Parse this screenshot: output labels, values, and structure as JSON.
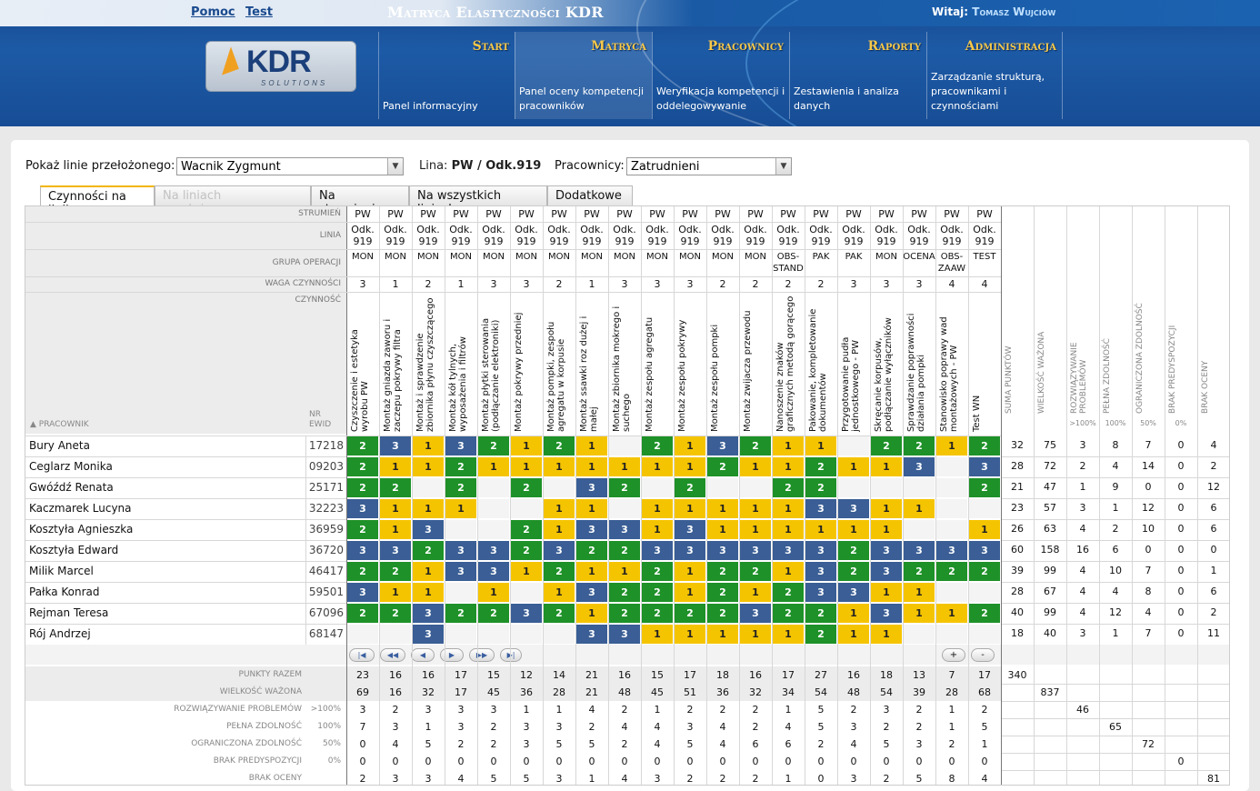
{
  "header": {
    "links": [
      "Pomoc",
      "Test"
    ],
    "app_title": "Matryca Elastyczności KDR",
    "welcome_prefix": "Witaj:",
    "user": "Tomasz Wujciów",
    "logo_text": "KDR",
    "logo_sub": "SOLUTIONS"
  },
  "nav": [
    {
      "title": "Start",
      "desc": "Panel informacyjny"
    },
    {
      "title": "Matryca",
      "desc": "Panel oceny kompetencji pracowników"
    },
    {
      "title": "Pracownicy",
      "desc": "Weryfikacja kompetencji i oddelegowywanie"
    },
    {
      "title": "Raporty",
      "desc": "Zestawienia i analiza danych"
    },
    {
      "title": "Administracja",
      "desc": "Zarządzanie strukturą, pracownikami i czynnościami"
    }
  ],
  "filters": {
    "supervisor_label": "Pokaż linie przełożonego:",
    "supervisor_value": "Wacnik Zygmunt",
    "line_label": "Lina:",
    "line_value": "PW / Odk.919",
    "workers_label": "Pracownicy:",
    "workers_value": "Zatrudnieni"
  },
  "tabs": [
    "Czynności na linii",
    "Na liniach przełożonego",
    "Na strumieniu",
    "Na wszystkich liniach",
    "Dodatkowe"
  ],
  "grid": {
    "row_headers": [
      "STRUMIEŃ",
      "LINIA",
      "GRUPA OPERACJI",
      "WAGA CZYNNOŚCI",
      "CZYNNOŚĆ"
    ],
    "employee_header": "▲ PRACOWNIK",
    "ewid_header": "NR EWID",
    "stream": [
      "PW",
      "PW",
      "PW",
      "PW",
      "PW",
      "PW",
      "PW",
      "PW",
      "PW",
      "PW",
      "PW",
      "PW",
      "PW",
      "PW",
      "PW",
      "PW",
      "PW",
      "PW",
      "PW",
      "PW"
    ],
    "line": [
      "Odk. 919",
      "Odk. 919",
      "Odk. 919",
      "Odk. 919",
      "Odk. 919",
      "Odk. 919",
      "Odk. 919",
      "Odk. 919",
      "Odk. 919",
      "Odk. 919",
      "Odk. 919",
      "Odk. 919",
      "Odk. 919",
      "Odk. 919",
      "Odk. 919",
      "Odk. 919",
      "Odk. 919",
      "Odk. 919",
      "Odk. 919",
      "Odk. 919"
    ],
    "group": [
      "MON",
      "MON",
      "MON",
      "MON",
      "MON",
      "MON",
      "MON",
      "MON",
      "MON",
      "MON",
      "MON",
      "MON",
      "MON",
      "OBS-STAND",
      "PAK",
      "PAK",
      "MON",
      "OCENA",
      "OBS-ZAAW",
      "TEST"
    ],
    "weight": [
      "3",
      "1",
      "2",
      "1",
      "3",
      "3",
      "2",
      "1",
      "3",
      "3",
      "3",
      "2",
      "2",
      "2",
      "2",
      "3",
      "3",
      "3",
      "4",
      "4"
    ],
    "activities": [
      "Czyszczenie i estetyka wyrobu PW",
      "Montaż gniazda zaworu i zaczepu pokrywy filtra",
      "Montaż i sprawdzenie zbiornika płynu czyszczącego",
      "Montaż kół tylnych, wyposażenia i filtrów",
      "Montaż płytki sterowania (podłączanie elektroniki)",
      "Montaż pokrywy przedniej",
      "Montaż pompki, zespołu agregatu w korpusie",
      "Montaż ssawki roz dużej i małej",
      "Montaż zbiornika mokrego i suchego",
      "Montaż zespołu agregatu",
      "Montaż zespołu pokrywy",
      "Montaż zespołu pompki",
      "Montaż zwijacza przewodu",
      "Nanoszenie znaków graficznych metodą gorącego",
      "Pakowanie, kompletowanie dokumentów",
      "Przygotowanie pudła jednostkowego - PW",
      "Skręcanie korpusów, podłączanie wyłączników",
      "Sprawdzanie poprawności działania pompki",
      "Stanowisko poprawy wad montażowych - PW",
      "Test WN"
    ],
    "summary_headers": [
      "SUMA PUNKTÓW",
      "WIELKOŚĆ WAŻONA",
      "ROZWIĄZYWANIE PROBLEMÓW",
      "PEŁNA ZDOLNOŚĆ",
      "OGRANICZONA ZDOLNOŚĆ",
      "BRAK PREDYSPOZYCJI",
      "BRAK OCENY"
    ],
    "summary_sub": [
      "",
      "",
      ">100%",
      "100%",
      "50%",
      "0%",
      ""
    ],
    "employees": [
      {
        "name": "Bury Aneta",
        "ewid": "17218",
        "levels": [
          "2",
          "3",
          "1",
          "3",
          "2",
          "1",
          "2",
          "1",
          "",
          "2",
          "1",
          "3",
          "2",
          "1",
          "1",
          "",
          "2",
          "2",
          "1",
          "2"
        ],
        "summary": [
          "32",
          "75",
          "3",
          "8",
          "7",
          "0",
          "4"
        ]
      },
      {
        "name": "Ceglarz Monika",
        "ewid": "09203",
        "levels": [
          "2",
          "1",
          "1",
          "2",
          "1",
          "1",
          "1",
          "1",
          "1",
          "1",
          "1",
          "2",
          "1",
          "1",
          "2",
          "1",
          "1",
          "3",
          "",
          "3"
        ],
        "summary": [
          "28",
          "72",
          "2",
          "4",
          "14",
          "0",
          "2"
        ]
      },
      {
        "name": "Gwóźdź Renata",
        "ewid": "25171",
        "levels": [
          "2",
          "2",
          "",
          "2",
          "",
          "2",
          "",
          "3",
          "2",
          "",
          "2",
          "",
          "",
          "2",
          "2",
          "",
          "",
          "",
          "",
          "2"
        ],
        "summary": [
          "21",
          "47",
          "1",
          "9",
          "0",
          "0",
          "12"
        ]
      },
      {
        "name": "Kaczmarek Lucyna",
        "ewid": "32223",
        "levels": [
          "3",
          "1",
          "1",
          "1",
          "",
          "",
          "1",
          "1",
          "",
          "1",
          "1",
          "1",
          "1",
          "1",
          "3",
          "3",
          "1",
          "1",
          "",
          ""
        ],
        "summary": [
          "23",
          "57",
          "3",
          "1",
          "12",
          "0",
          "6"
        ]
      },
      {
        "name": "Kosztyła Agnieszka",
        "ewid": "36959",
        "levels": [
          "2",
          "1",
          "3",
          "",
          "",
          "2",
          "1",
          "3",
          "3",
          "1",
          "3",
          "1",
          "1",
          "1",
          "1",
          "1",
          "1",
          "",
          "",
          "1"
        ],
        "summary": [
          "26",
          "63",
          "4",
          "2",
          "10",
          "0",
          "6"
        ]
      },
      {
        "name": "Kosztyła Edward",
        "ewid": "36720",
        "levels": [
          "3",
          "3",
          "2",
          "3",
          "3",
          "2",
          "3",
          "2",
          "2",
          "3",
          "3",
          "3",
          "3",
          "3",
          "3",
          "2",
          "3",
          "3",
          "3",
          "3"
        ],
        "summary": [
          "60",
          "158",
          "16",
          "6",
          "0",
          "0",
          "0"
        ]
      },
      {
        "name": "Milik Marcel",
        "ewid": "46417",
        "levels": [
          "2",
          "2",
          "1",
          "3",
          "3",
          "1",
          "2",
          "1",
          "1",
          "2",
          "1",
          "2",
          "2",
          "1",
          "3",
          "2",
          "3",
          "2",
          "2",
          "2"
        ],
        "summary": [
          "39",
          "99",
          "4",
          "10",
          "7",
          "0",
          "1"
        ]
      },
      {
        "name": "Pałka Konrad",
        "ewid": "59501",
        "levels": [
          "3",
          "1",
          "1",
          "",
          "1",
          "",
          "1",
          "3",
          "2",
          "2",
          "1",
          "2",
          "1",
          "2",
          "3",
          "3",
          "1",
          "1",
          "",
          ""
        ],
        "summary": [
          "28",
          "67",
          "4",
          "4",
          "8",
          "0",
          "6"
        ]
      },
      {
        "name": "Rejman Teresa",
        "ewid": "67096",
        "levels": [
          "2",
          "2",
          "3",
          "2",
          "2",
          "3",
          "2",
          "1",
          "2",
          "2",
          "2",
          "2",
          "3",
          "2",
          "2",
          "1",
          "3",
          "1",
          "1",
          "2"
        ],
        "summary": [
          "40",
          "99",
          "4",
          "12",
          "4",
          "0",
          "2"
        ]
      },
      {
        "name": "Rój Andrzej",
        "ewid": "68147",
        "levels": [
          "",
          "",
          "3",
          "",
          "",
          "",
          "",
          "3",
          "3",
          "1",
          "1",
          "1",
          "1",
          "1",
          "2",
          "1",
          "1",
          "",
          "",
          ""
        ],
        "summary": [
          "18",
          "40",
          "3",
          "1",
          "7",
          "0",
          "11"
        ]
      }
    ],
    "totals": [
      {
        "label": "PUNKTY RAZEM",
        "sub": "",
        "values": [
          "23",
          "16",
          "16",
          "17",
          "15",
          "12",
          "14",
          "21",
          "16",
          "15",
          "17",
          "18",
          "16",
          "17",
          "27",
          "16",
          "18",
          "13",
          "7",
          "17"
        ],
        "extra": [
          "340",
          "",
          "",
          "",
          "",
          "",
          ""
        ]
      },
      {
        "label": "WIELKOŚĆ WAŻONA",
        "sub": "",
        "values": [
          "69",
          "16",
          "32",
          "17",
          "45",
          "36",
          "28",
          "21",
          "48",
          "45",
          "51",
          "36",
          "32",
          "34",
          "54",
          "48",
          "54",
          "39",
          "28",
          "68"
        ],
        "extra": [
          "",
          "837",
          "",
          "",
          "",
          "",
          ""
        ]
      },
      {
        "label": "ROZWIĄZYWANIE PROBLEMÓW",
        "sub": ">100%",
        "values": [
          "3",
          "2",
          "3",
          "3",
          "3",
          "1",
          "1",
          "4",
          "2",
          "1",
          "2",
          "2",
          "2",
          "1",
          "5",
          "2",
          "3",
          "2",
          "1",
          "2"
        ],
        "extra": [
          "",
          "",
          "46",
          "",
          "",
          "",
          ""
        ]
      },
      {
        "label": "PEŁNA ZDOLNOŚĆ",
        "sub": "100%",
        "values": [
          "7",
          "3",
          "1",
          "3",
          "2",
          "3",
          "3",
          "2",
          "4",
          "4",
          "3",
          "4",
          "2",
          "4",
          "5",
          "3",
          "2",
          "2",
          "1",
          "5"
        ],
        "extra": [
          "",
          "",
          "",
          "65",
          "",
          "",
          ""
        ]
      },
      {
        "label": "OGRANICZONA ZDOLNOŚĆ",
        "sub": "50%",
        "values": [
          "0",
          "4",
          "5",
          "2",
          "2",
          "3",
          "5",
          "5",
          "2",
          "4",
          "5",
          "4",
          "6",
          "6",
          "2",
          "4",
          "5",
          "3",
          "2",
          "1"
        ],
        "extra": [
          "",
          "",
          "",
          "",
          "72",
          "",
          ""
        ]
      },
      {
        "label": "BRAK PREDYSPOZYCJI",
        "sub": "0%",
        "values": [
          "0",
          "0",
          "0",
          "0",
          "0",
          "0",
          "0",
          "0",
          "0",
          "0",
          "0",
          "0",
          "0",
          "0",
          "0",
          "0",
          "0",
          "0",
          "0",
          "0"
        ],
        "extra": [
          "",
          "",
          "",
          "",
          "",
          "0",
          ""
        ]
      },
      {
        "label": "BRAK OCENY",
        "sub": "",
        "values": [
          "2",
          "3",
          "3",
          "4",
          "5",
          "5",
          "3",
          "1",
          "4",
          "3",
          "2",
          "2",
          "2",
          "1",
          "0",
          "3",
          "2",
          "5",
          "8",
          "4"
        ],
        "extra": [
          "",
          "",
          "",
          "",
          "",
          "",
          "81"
        ]
      }
    ],
    "pager": [
      "|◀",
      "◀◀",
      "◀",
      "▶",
      "▶▶",
      "▶|"
    ],
    "zoom": [
      "+",
      "-"
    ]
  }
}
